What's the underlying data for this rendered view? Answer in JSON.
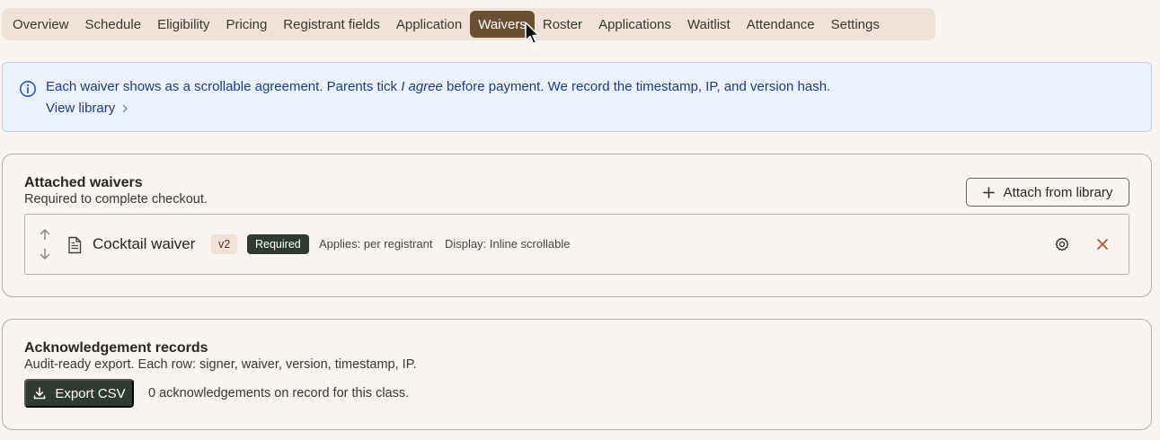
{
  "tabs": [
    {
      "label": "Overview",
      "active": false
    },
    {
      "label": "Schedule",
      "active": false
    },
    {
      "label": "Eligibility",
      "active": false
    },
    {
      "label": "Pricing",
      "active": false
    },
    {
      "label": "Registrant fields",
      "active": false
    },
    {
      "label": "Application",
      "active": false
    },
    {
      "label": "Waivers",
      "active": true
    },
    {
      "label": "Roster",
      "active": false
    },
    {
      "label": "Applications",
      "active": false
    },
    {
      "label": "Waitlist",
      "active": false
    },
    {
      "label": "Attendance",
      "active": false
    },
    {
      "label": "Settings",
      "active": false
    }
  ],
  "info": {
    "text_before": "Each waiver shows as a scrollable agreement. Parents tick ",
    "text_emphasis": "I agree",
    "text_after": " before payment. We record the timestamp, IP, and version hash.",
    "link_label": "View library"
  },
  "attached": {
    "title": "Attached waivers",
    "subtitle": "Required to complete checkout.",
    "attach_button": "Attach from library",
    "waivers": [
      {
        "name": "Cocktail waiver",
        "version": "v2",
        "status": "Required",
        "applies": "Applies: per registrant",
        "display": "Display: Inline scrollable"
      }
    ]
  },
  "records": {
    "title": "Acknowledgement records",
    "subtitle": "Audit-ready export. Each row: signer, waiver, version, timestamp, IP.",
    "export_button": "Export CSV",
    "count_text": "0 acknowledgements on record for this class."
  },
  "colors": {
    "active_tab": "#6b4f33",
    "dark_button": "#2f3a30",
    "info_text": "#1e3b82",
    "info_bg": "#ecf2fd",
    "remove_icon": "#b0532e"
  }
}
